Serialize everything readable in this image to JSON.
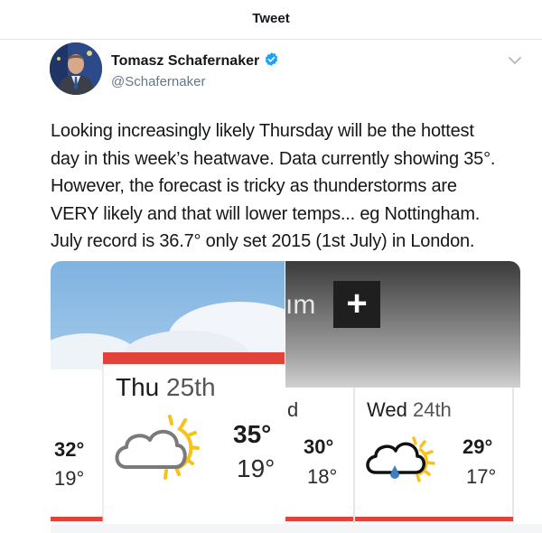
{
  "header": {
    "title": "Tweet"
  },
  "author": {
    "name": "Tomasz Schafernaker",
    "handle": "@Schafernaker"
  },
  "tweet": {
    "lines": [
      "Looking increasingly likely Thursday will be the hottest",
      "day in this week’s heatwave. Data currently showing 35°.",
      "However, the forecast is tricky as thunderstorms are",
      "VERY likely and that will lower temps... eg Nottingham.",
      "July record is 36.7° only set 2015 (1st July) in London."
    ]
  },
  "forecast_left": {
    "left_edge_high": "32°",
    "left_edge_low": "19°",
    "featured": {
      "day": "Thu",
      "date": "25th",
      "high": "35°",
      "low": "19°",
      "icon": "partly-cloudy-sun-icon"
    }
  },
  "forecast_right": {
    "header_fragment": "ım",
    "plus_label": "+",
    "left_edge_high": "30°",
    "left_edge_low": "18°",
    "day_fragment": "d",
    "card": {
      "day": "Wed",
      "date": "24th",
      "high": "29°",
      "low": "17°",
      "icon": "sun-cloud-rain-icon"
    }
  },
  "colors": {
    "accent_red": "#e2423a",
    "sun_yellow": "#f7c21b",
    "rain_blue": "#3e7fc1",
    "verified_blue": "#1da1f2",
    "sky_blue": "#8fbfe6"
  }
}
